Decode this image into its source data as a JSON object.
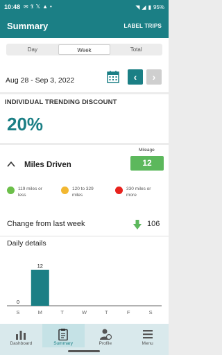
{
  "status_bar": {
    "time": "10:48",
    "battery": "95%"
  },
  "app_bar": {
    "title": "Summary",
    "action": "LABEL TRIPS"
  },
  "segments": [
    {
      "label": "Day",
      "active": false
    },
    {
      "label": "Week",
      "active": true
    },
    {
      "label": "Total",
      "active": false
    }
  ],
  "date_range": "Aug 28 - Sep 3, 2022",
  "discount": {
    "label": "INDIVIDUAL TRENDING DISCOUNT",
    "value": "20%"
  },
  "miles": {
    "mileage_label": "Mileage",
    "mileage_value": "12",
    "title": "Miles Driven",
    "legend": [
      {
        "text": "119 miles or less",
        "color": "#6cbf4a"
      },
      {
        "text": "120 to 329 miles",
        "color": "#f2b731"
      },
      {
        "text": "330 miles or more",
        "color": "#e8221d"
      }
    ],
    "change_label": "Change from last week",
    "change_value": "106",
    "daily_title": "Daily details"
  },
  "chart_data": {
    "type": "bar",
    "categories": [
      "S",
      "M",
      "T",
      "W",
      "T",
      "F",
      "S"
    ],
    "values": [
      0,
      12,
      null,
      null,
      null,
      null,
      null
    ],
    "data_labels": [
      "0",
      "12",
      "",
      "",
      "",
      "",
      ""
    ],
    "bar_color": "#1b7f85"
  },
  "bottom_nav": [
    {
      "label": "Dashboard",
      "icon": "bar-chart-icon",
      "active": false
    },
    {
      "label": "Summary",
      "icon": "clipboard-icon",
      "active": true
    },
    {
      "label": "Profile",
      "icon": "profile-icon",
      "active": false
    },
    {
      "label": "Menu",
      "icon": "hamburger-icon",
      "active": false
    }
  ]
}
